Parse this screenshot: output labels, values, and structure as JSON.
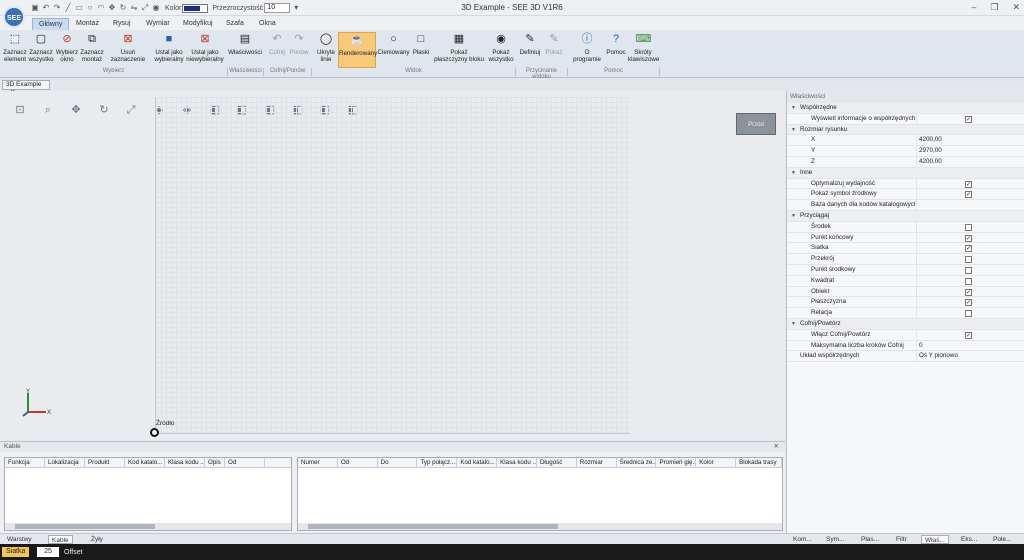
{
  "window": {
    "title": "3D Example - SEE 3D V1R6",
    "logo": "SEE 3D"
  },
  "qat": {
    "kolor_label": "Kolor",
    "przezroczystosc_label": "Przezroczystość",
    "przezroczystosc_value": "10"
  },
  "tabs": [
    "Główny",
    "Montaż",
    "Rysuj",
    "Wymiar",
    "Modyfikuj",
    "Szafa",
    "Okna"
  ],
  "ribbon": {
    "zaznacz_element": "Zaznacz element",
    "zaznacz_wszystko": "Zaznacz wszystko",
    "wybierz_okno": "Wybierz okno",
    "zaznacz_montaz": "Zaznacz montaż",
    "usun_zaznaczenie": "Usuń zaznaczenie",
    "ustal_wybieralny": "Ustal jako wybieralny",
    "ustal_niewybieralny": "Ustal jako niewybieralny",
    "wlasciwosci": "Właściwości",
    "cofnij": "Cofnij",
    "ponow": "Ponów",
    "ukryte_linie": "Ukryte linie",
    "renderowany": "Renderowany",
    "cieniowany": "Cieniowany",
    "plaski": "Płaski",
    "pokaz_plaszczyzny": "Pokaż płaszczyzny bloku",
    "pokaz_wszystko": "Pokaż wszystko",
    "definiuj": "Definiuj",
    "pokaz": "Pokaż",
    "o_programie": "O programie",
    "pomoc": "Pomoc",
    "skroty": "Skróty klawiszowe",
    "groups": {
      "wybierz": "Wybierz",
      "wlasciwosci": "Właściwości",
      "cofnij_ponow": "Cofnij/Ponów",
      "widok": "Widok",
      "przycinanie": "Przycinanie widoku",
      "pomoc": "Pomoc"
    }
  },
  "document_tab": "3D Example",
  "viewport": {
    "cube_label": "Przód",
    "axis_x": "X",
    "axis_y": "Y",
    "origin_label": "Źródło"
  },
  "kable_panel": {
    "title": "Kable",
    "left_columns": [
      "Funkcja",
      "Lokalizacja",
      "Produkt",
      "Kod katalo...",
      "Klasa kodu ...",
      "Opis",
      "Od"
    ],
    "right_columns": [
      "Numer",
      "Od",
      "Do",
      "Typ połącz...",
      "Kod katalo...",
      "Klasa kodu ...",
      "Długość",
      "Rozmiar",
      "Średnica ze...",
      "Promień gię...",
      "Kolor",
      "Blokada trasy"
    ]
  },
  "bottom_tabs": [
    "Warstwy",
    "Kable",
    "Żyły"
  ],
  "right_bottom_tabs": [
    "Kom...",
    "Sym...",
    "Płas...",
    "Filtr",
    "Właś...",
    "Eks...",
    "Pole..."
  ],
  "status": {
    "snap_label": "Siatka",
    "snap_value": "25",
    "offset_label": "Offset"
  },
  "properties": {
    "title": "Właściwości",
    "rows": [
      {
        "type": "cat",
        "label": "Współrzędne"
      },
      {
        "type": "prop",
        "label": "Wyświetl informacje o współrzędnych",
        "check": true
      },
      {
        "type": "cat",
        "label": "Rozmiar rysunku"
      },
      {
        "type": "prop",
        "label": "X",
        "value": "4200,00"
      },
      {
        "type": "prop",
        "label": "Y",
        "value": "2970,00"
      },
      {
        "type": "prop",
        "label": "Z",
        "value": "4200,00"
      },
      {
        "type": "cat",
        "label": "Inne"
      },
      {
        "type": "prop",
        "label": "Optymalizuj wydajność",
        "check": true
      },
      {
        "type": "prop",
        "label": "Pokaż symbol źródłowy",
        "check": true
      },
      {
        "type": "prop",
        "label": "Baza danych dla kodów katalogowych",
        "value": ""
      },
      {
        "type": "cat",
        "label": "Przyciągaj"
      },
      {
        "type": "prop",
        "label": "Środek",
        "check": false
      },
      {
        "type": "prop",
        "label": "Punkt końcowy",
        "check": true
      },
      {
        "type": "prop",
        "label": "Siatka",
        "check": true
      },
      {
        "type": "prop",
        "label": "Przekrój",
        "check": false
      },
      {
        "type": "prop",
        "label": "Punkt środkowy",
        "check": false
      },
      {
        "type": "prop",
        "label": "Kwadrat",
        "check": false
      },
      {
        "type": "prop",
        "label": "Obiekt",
        "check": true
      },
      {
        "type": "prop",
        "label": "Płaszczyzna",
        "check": true
      },
      {
        "type": "prop",
        "label": "Relacja",
        "check": false
      },
      {
        "type": "cat",
        "label": "Cofnij/Powtórz"
      },
      {
        "type": "prop",
        "label": "Włącz Cofnij/Powtórz",
        "check": true
      },
      {
        "type": "prop",
        "label": "Maksymalna liczba kroków Cofnij",
        "value": "0"
      },
      {
        "type": "top",
        "label": "Układ współrzędnych",
        "value": "Oś Y pionowo"
      }
    ]
  }
}
